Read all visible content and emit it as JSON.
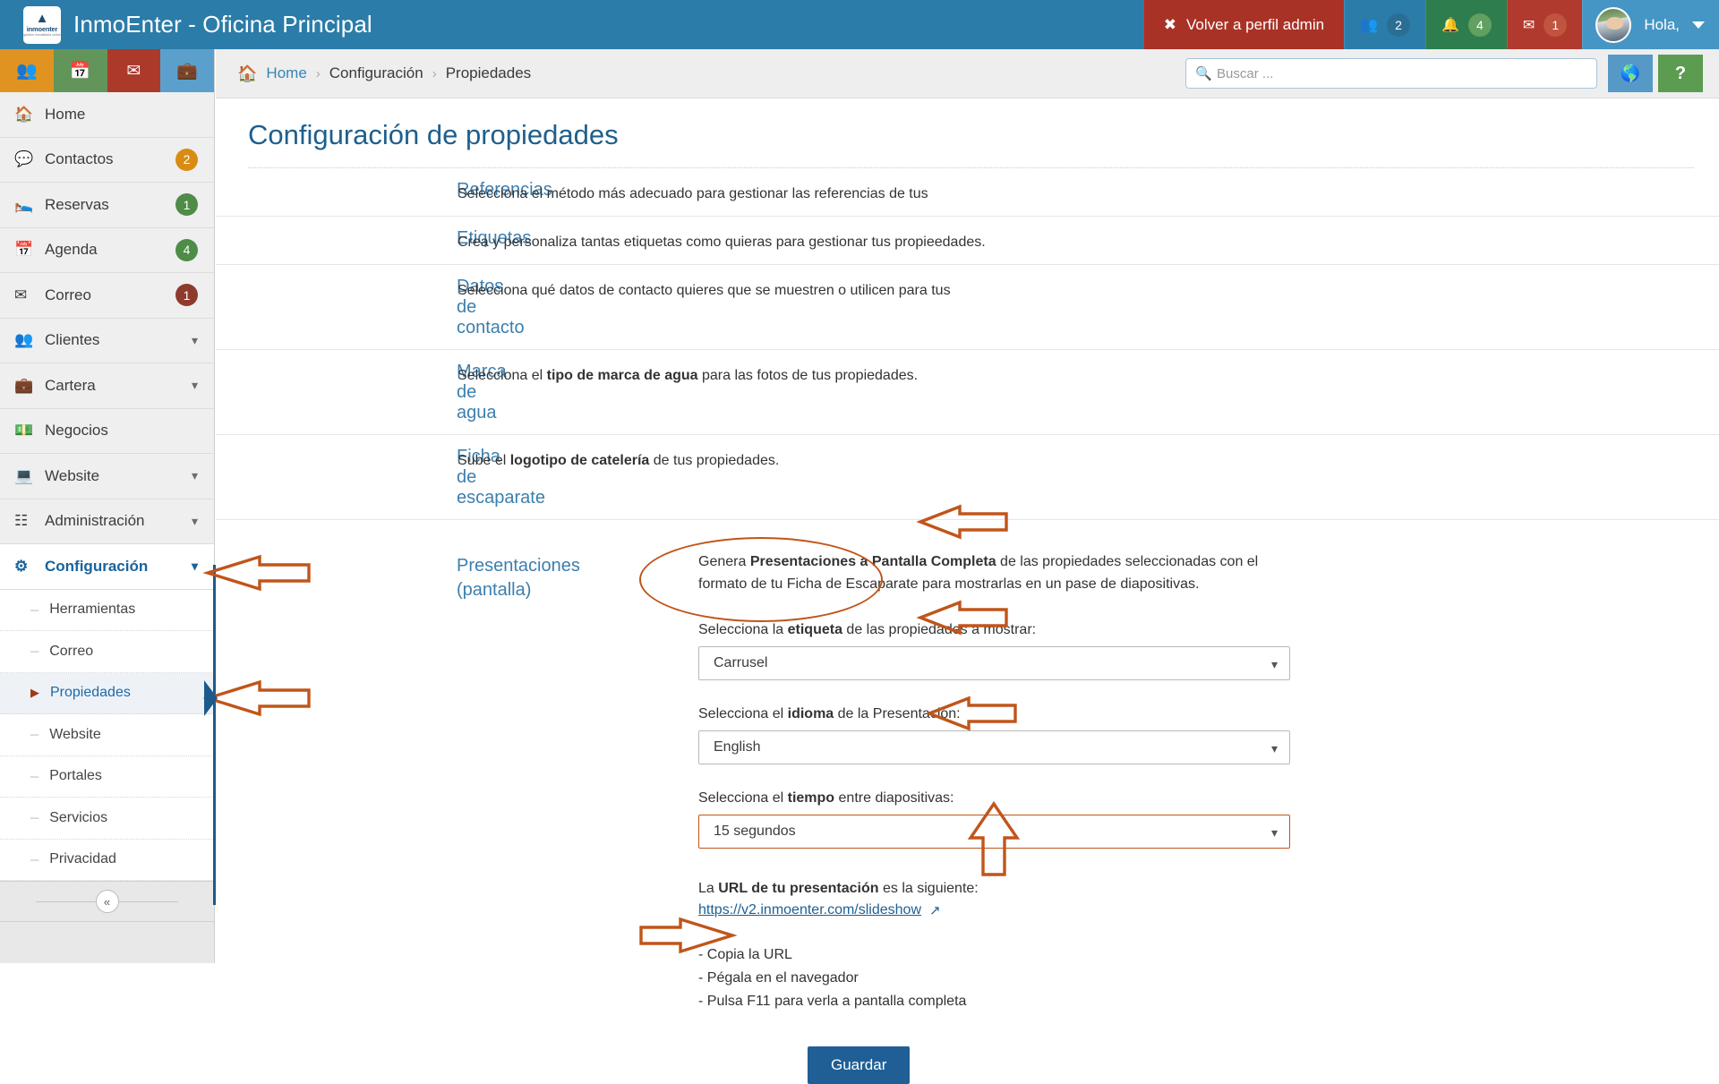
{
  "topbar": {
    "brand_title": "InmoEnter - Oficina Principal",
    "logo_wordmark": "inmoenter",
    "logo_tagline": "gestión inmobiliaria online",
    "volver_label": "Volver a perfil admin",
    "volver_icon": "close-x-icon",
    "users_icon": "users-icon",
    "users_count": "2",
    "bell_icon": "bell-icon",
    "bell_count": "4",
    "mail_icon": "envelope-icon",
    "mail_count": "1",
    "greeting": "Hola,",
    "caret_icon": "chevron-down-icon",
    "colors": {
      "bar": "#2b7ca8",
      "volver": "#a93226",
      "bell": "#2e7d4f",
      "mail": "#b03a2e"
    }
  },
  "quick_icons": [
    {
      "name": "contacts-quick-icon",
      "glyph": "C",
      "color": "#e09320"
    },
    {
      "name": "calendar-quick-icon",
      "glyph": "C",
      "color": "#62955a"
    },
    {
      "name": "mail-quick-icon",
      "glyph": "C",
      "color": "#ab3a2b"
    },
    {
      "name": "briefcase-quick-icon",
      "glyph": "C",
      "color": "#5ba0cd"
    }
  ],
  "sidebar": {
    "items": [
      {
        "label": "Home",
        "icon": "home-icon",
        "badge": "",
        "chevron": false
      },
      {
        "label": "Contactos",
        "icon": "comment-icon",
        "badge": "2",
        "badge_color": "orange",
        "chevron": false
      },
      {
        "label": "Reservas",
        "icon": "bed-icon",
        "badge": "1",
        "badge_color": "green",
        "chevron": false
      },
      {
        "label": "Agenda",
        "icon": "calendar-icon",
        "badge": "4",
        "badge_color": "green",
        "chevron": false
      },
      {
        "label": "Correo",
        "icon": "envelope-icon",
        "badge": "1",
        "badge_color": "red",
        "chevron": false
      },
      {
        "label": "Clientes",
        "icon": "users-icon",
        "badge": "",
        "chevron": true
      },
      {
        "label": "Cartera",
        "icon": "briefcase-icon",
        "badge": "",
        "chevron": true
      },
      {
        "label": "Negocios",
        "icon": "money-icon",
        "badge": "",
        "chevron": false
      },
      {
        "label": "Website",
        "icon": "monitor-icon",
        "badge": "",
        "chevron": true
      },
      {
        "label": "Administración",
        "icon": "sitemap-icon",
        "badge": "",
        "chevron": true
      }
    ],
    "active_parent": {
      "label": "Configuración",
      "icon": "gears-icon",
      "chevron": true
    },
    "sub_items": [
      {
        "label": "Herramientas",
        "active": false
      },
      {
        "label": "Correo",
        "active": false
      },
      {
        "label": "Propiedades",
        "active": true
      },
      {
        "label": "Website",
        "active": false
      },
      {
        "label": "Portales",
        "active": false
      },
      {
        "label": "Servicios",
        "active": false
      },
      {
        "label": "Privacidad",
        "active": false
      }
    ],
    "collapse_icon": "double-chevron-left-icon"
  },
  "crumbbar": {
    "home_icon": "home-icon",
    "crumbs": [
      "Home",
      "Configuración",
      "Propiedades"
    ],
    "separator": "›",
    "search": {
      "placeholder": "Buscar ...",
      "value": "",
      "icon": "search-icon"
    },
    "globe_button": {
      "icon": "globe-icon"
    },
    "help_button": {
      "label": "?"
    }
  },
  "main": {
    "page_title": "Configuración de propiedades",
    "rows": [
      {
        "link": "Referencias",
        "desc_pre": "Selecciona el método más adecuado para gestionar las referencias de tus",
        "desc_bold": "",
        "desc_post": ""
      },
      {
        "link": "Etiquetas",
        "desc_pre": "Crea y personaliza tantas etiquetas como quieras para gestionar tus propieedades.",
        "desc_bold": "",
        "desc_post": ""
      },
      {
        "link": "Datos de contacto",
        "desc_pre": "Selecciona qué datos de contacto quieres que se muestren o utilicen para tus",
        "desc_bold": "",
        "desc_post": ""
      },
      {
        "link": "Marca de agua",
        "desc_pre": "Selecciona el ",
        "desc_bold": "tipo de marca de agua",
        "desc_post": " para las fotos de tus propiedades."
      },
      {
        "link": "Ficha de escaparate",
        "desc_pre": "Sube el ",
        "desc_bold": "logotipo de catelería",
        "desc_post": " de tus propiedades."
      }
    ],
    "presentations": {
      "link_line1": "Presentaciones",
      "link_line2": "(pantalla)",
      "para_pre": "Genera ",
      "para_bold": "Presentaciones a Pantalla Completa",
      "para_post": " de las propiedades seleccionadas con el formato de tu Ficha de Escaparate para mostrarlas en un pase de diapositivas.",
      "fields": [
        {
          "label_pre": "Selecciona la ",
          "label_bold": "etiqueta",
          "label_post": " de las propiedades a mostrar:",
          "value": "Carrusel",
          "highlight": false,
          "name": "etiqueta-select"
        },
        {
          "label_pre": "Selecciona el ",
          "label_bold": "idioma",
          "label_post": " de la Presentación:",
          "value": "English",
          "highlight": false,
          "name": "idioma-select"
        },
        {
          "label_pre": "Selecciona el ",
          "label_bold": "tiempo",
          "label_post": " entre diapositivas:",
          "value": "15 segundos",
          "highlight": true,
          "name": "tiempo-select"
        }
      ],
      "url_label_pre": "La ",
      "url_label_bold": "URL de tu presentación",
      "url_label_post": " es la siguiente:",
      "url": "https://v2.inmoenter.com/slideshow",
      "url_icon": "external-link-icon",
      "steps": [
        "- Copia la URL",
        "- Pégala en el navegador",
        "- Pulsa F11 para verla a pantalla completa"
      ],
      "save_label": "Guardar"
    }
  },
  "annotations": {
    "color": "#c0551a",
    "items": [
      "arrow-to-configuracion-chevron",
      "arrow-to-propiedades-subitem",
      "ellipse-around-presentaciones-link",
      "arrow-to-etiqueta-select",
      "arrow-to-idioma-select",
      "arrow-to-tiempo-select",
      "arrow-up-to-url-link",
      "arrow-to-guardar-button"
    ]
  }
}
